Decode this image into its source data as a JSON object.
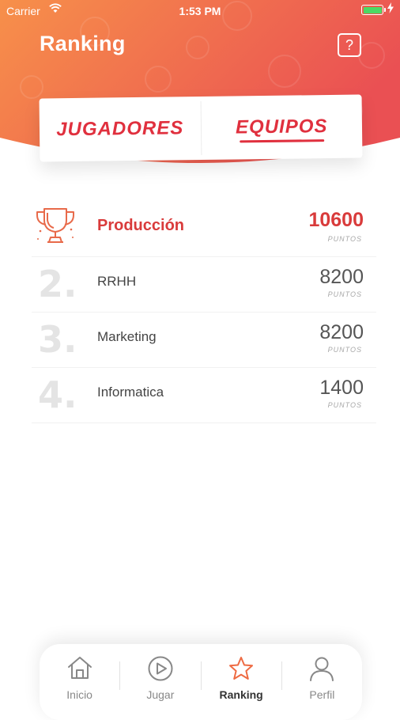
{
  "status_bar": {
    "carrier": "Carrier",
    "time": "1:53 PM"
  },
  "header": {
    "title": "Ranking",
    "help_label": "?"
  },
  "tabs": [
    {
      "label": "JUGADORES",
      "active": false
    },
    {
      "label": "EQUIPOS",
      "active": true
    }
  ],
  "ranking": {
    "unit_label": "PUNTOS",
    "rows": [
      {
        "position": "1.",
        "team": "Producción",
        "points": "10600"
      },
      {
        "position": "2.",
        "team": "RRHH",
        "points": "8200"
      },
      {
        "position": "3.",
        "team": "Marketing",
        "points": "8200"
      },
      {
        "position": "4.",
        "team": "Informatica",
        "points": "1400"
      }
    ]
  },
  "tab_bar": {
    "items": [
      {
        "label": "Inicio",
        "icon": "home-icon",
        "active": false
      },
      {
        "label": "Jugar",
        "icon": "play-icon",
        "active": false
      },
      {
        "label": "Ranking",
        "icon": "star-icon",
        "active": true
      },
      {
        "label": "Perfil",
        "icon": "user-icon",
        "active": false
      }
    ]
  },
  "colors": {
    "accent": "#e0303e",
    "gradient_start": "#f7904a",
    "gradient_end": "#ea5053"
  }
}
